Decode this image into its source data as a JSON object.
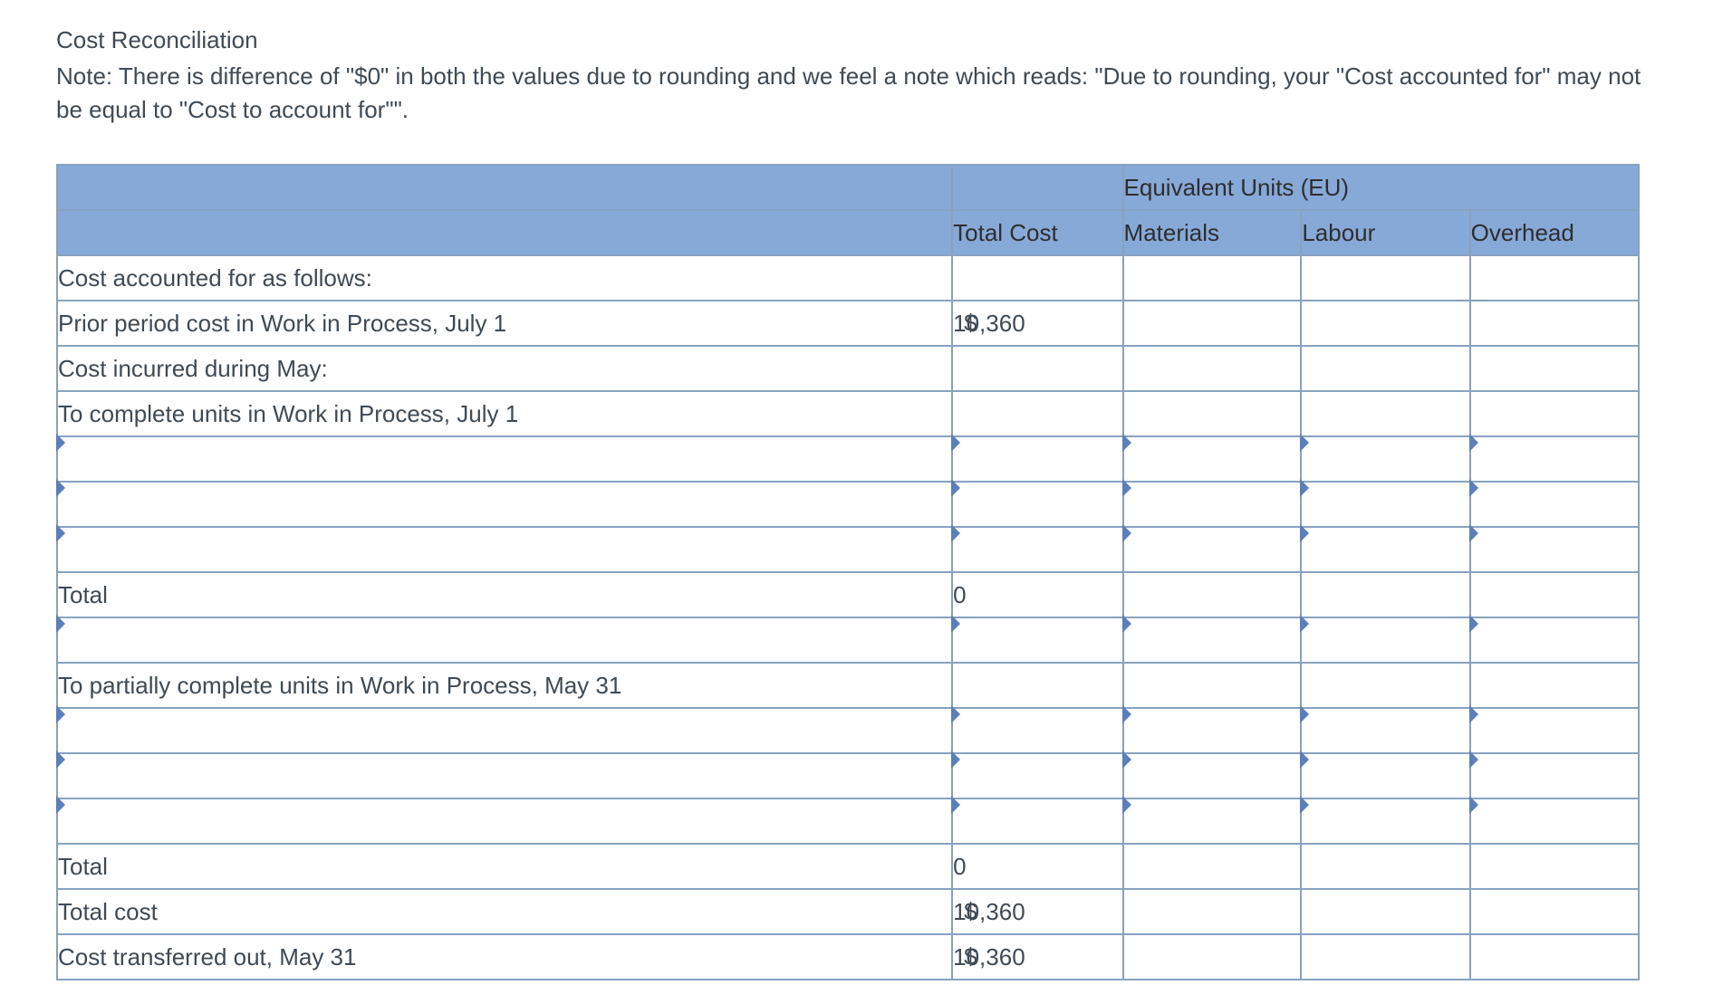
{
  "title": "Cost Reconciliation",
  "note": "Note: There is difference of \"$0\" in both the values due to rounding and we feel a note which reads: \"Due to rounding, your \"Cost accounted for\" may not be equal to \"Cost to account for\"\".",
  "columns": {
    "total_cost": "Total Cost",
    "eu_group": "Equivalent Units (EU)",
    "materials": "Materials",
    "labour": "Labour",
    "overhead": "Overhead"
  },
  "rows": {
    "r1": {
      "label": "Cost accounted for as follows:"
    },
    "r2": {
      "label": "Prior period cost in Work in Process, July 1",
      "total_cost_sym": "$",
      "total_cost_val": "10,360"
    },
    "r3": {
      "label": "Cost incurred during May:"
    },
    "r4": {
      "label": "To complete units in Work in Process, July 1"
    },
    "r5_blank1": {},
    "r5_blank2": {},
    "r5_blank3": {},
    "r6": {
      "label": "Total",
      "total_cost_val": "0"
    },
    "r6_blank": {},
    "r7": {
      "label": "To partially complete units in Work in Process, May 31"
    },
    "r7_blank1": {},
    "r7_blank2": {},
    "r7_blank3": {},
    "r8": {
      "label": "Total",
      "total_cost_val": "0"
    },
    "r9": {
      "label": "Total cost",
      "total_cost_sym": "$",
      "total_cost_val": "10,360"
    },
    "r10": {
      "label": "Cost transferred out, May 31",
      "total_cost_sym": "$",
      "total_cost_val": "10,360"
    }
  }
}
